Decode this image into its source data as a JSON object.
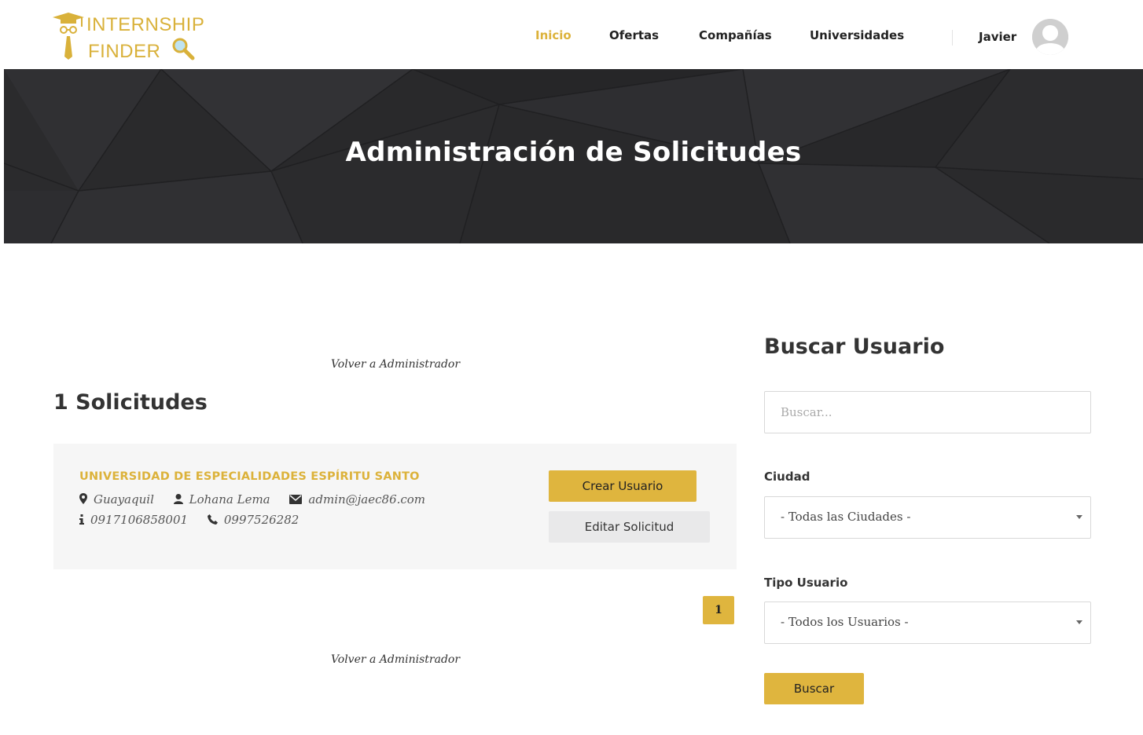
{
  "logo": {
    "line1": "INTERNSHIP",
    "line2": "FINDER"
  },
  "nav": {
    "items": [
      {
        "label": "Inicio",
        "active": true
      },
      {
        "label": "Ofertas",
        "active": false
      },
      {
        "label": "Compañías",
        "active": false
      },
      {
        "label": "Universidades",
        "active": false
      }
    ],
    "user_name": "Javier"
  },
  "hero": {
    "title": "Administración de Solicitudes"
  },
  "main": {
    "back_link_top": "Volver a Administrador",
    "count_title": "1 Solicitudes",
    "request": {
      "university": "UNIVERSIDAD DE ESPECIALIDADES ESPÍRITU SANTO",
      "city": "Guayaquil",
      "contact": "Lohana Lema",
      "email": "admin@jaec86.com",
      "ruc": "0917106858001",
      "phone": "0997526282",
      "create_label": "Crear Usuario",
      "edit_label": "Editar Solicitud"
    },
    "pagination": {
      "current": "1"
    },
    "back_link_bottom": "Volver a Administrador"
  },
  "sidebar": {
    "title": "Buscar Usuario",
    "search_placeholder": "Buscar...",
    "city_label": "Ciudad",
    "city_value": "- Todas las Ciudades -",
    "type_label": "Tipo Usuario",
    "type_value": "- Todos los Usuarios -",
    "search_button": "Buscar"
  },
  "colors": {
    "accent": "#dfb53e",
    "hero_bg": "#2b2b2d",
    "card_bg": "#f6f6f6"
  }
}
